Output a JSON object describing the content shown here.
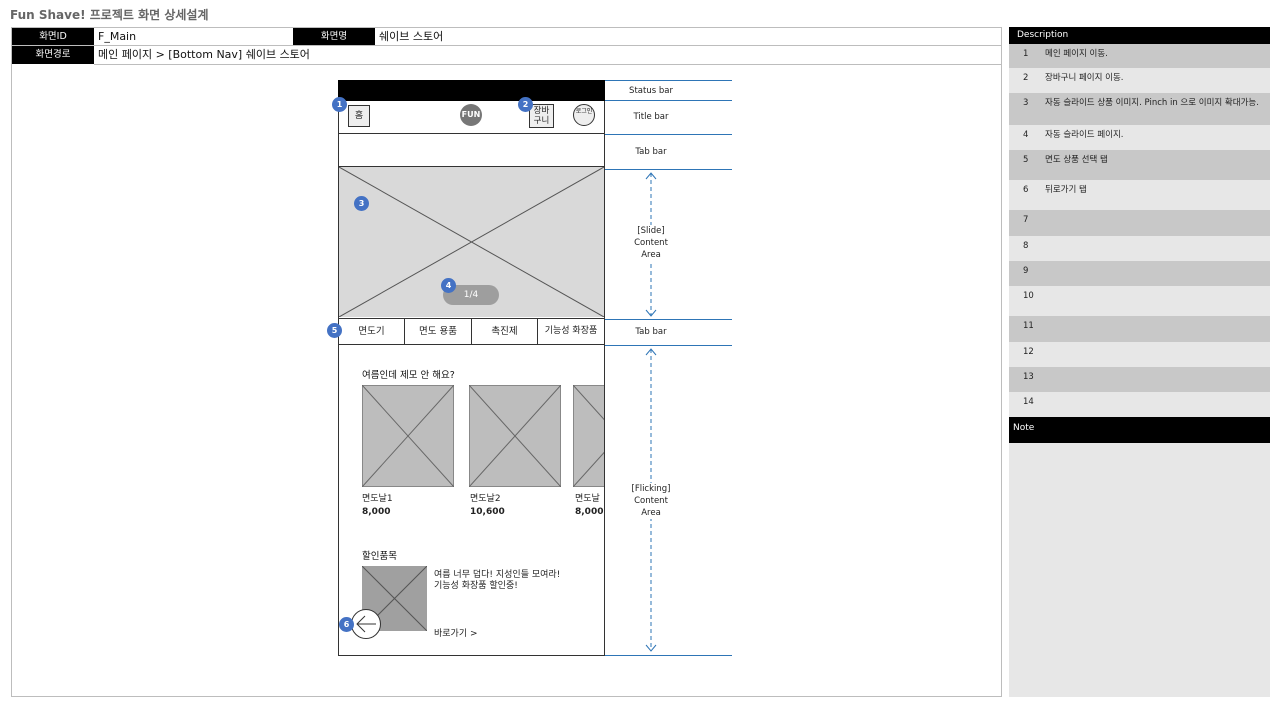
{
  "doc": {
    "title": "Fun Shave! 프로젝트 화면 상세설계"
  },
  "header": {
    "screen_id_label": "화면ID",
    "screen_id": "F_Main",
    "screen_name_label": "화면명",
    "screen_name": "쉐이브 스토어",
    "path_label": "화면경로",
    "path": "메인 페이지 > [Bottom Nav] 쉐이브 스토어"
  },
  "mockup": {
    "home_label": "홈",
    "logo_label": "FUN",
    "cart_label": "장바구니",
    "login_label": "로그인",
    "pager": "1/4",
    "category_tabs": [
      "면도기",
      "면도 용품",
      "촉진제",
      "기능성 화장품"
    ],
    "section_title": "여름인데 제모 안 해요?",
    "products": [
      {
        "name": "면도날1",
        "price": "8,000"
      },
      {
        "name": "면도날2",
        "price": "10,600"
      },
      {
        "name": "면도날",
        "price": "8,000"
      }
    ],
    "promo_title": "할인품목",
    "promo_text_1": "여름 너무 덥다! 지성인들 모여라!",
    "promo_text_2": "기능성 화장품 할인중!",
    "promo_link": "바로가기 >"
  },
  "badges": [
    "1",
    "2",
    "3",
    "4",
    "5",
    "6"
  ],
  "regions": {
    "status_bar": "Status bar",
    "title_bar": "Title bar",
    "tab_bar_top": "Tab bar",
    "slide_1": "[Slide]",
    "slide_2": "Content",
    "slide_3": "Area",
    "tab_bar_mid": "Tab bar",
    "flick_1": "[Flicking]",
    "flick_2": "Content",
    "flick_3": "Area"
  },
  "description": {
    "header": "Description",
    "rows": [
      {
        "num": "1",
        "text": "메인 페이지 이동."
      },
      {
        "num": "2",
        "text": "장바구니 페이지 이동."
      },
      {
        "num": "3",
        "text": "자동 슬라이드 상품 이미지. Pinch in 으로 이미지 확대가능."
      },
      {
        "num": "4",
        "text": "자동 슬라이드 페이지."
      },
      {
        "num": "5",
        "text": "면도 상품 선택 탭"
      },
      {
        "num": "6",
        "text": "뒤로가기 탭"
      },
      {
        "num": "7",
        "text": ""
      },
      {
        "num": "8",
        "text": ""
      },
      {
        "num": "9",
        "text": ""
      },
      {
        "num": "10",
        "text": ""
      },
      {
        "num": "11",
        "text": ""
      },
      {
        "num": "12",
        "text": ""
      },
      {
        "num": "13",
        "text": ""
      },
      {
        "num": "14",
        "text": ""
      }
    ],
    "note_label": "Note"
  },
  "colors": {
    "badge": "#4472c4",
    "region_line": "#2e75b6",
    "placeholder": "#d9d9d9",
    "row_dark": "#c8c8c8",
    "row_light": "#e7e7e7"
  }
}
